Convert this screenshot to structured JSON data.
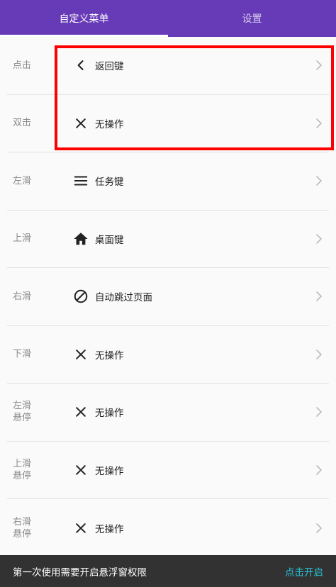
{
  "tabs": [
    {
      "label": "自定义菜单",
      "active": true
    },
    {
      "label": "设置",
      "active": false
    }
  ],
  "rows": [
    {
      "gesture": "点击",
      "action": "返回键",
      "icon": "chevron-left-icon"
    },
    {
      "gesture": "双击",
      "action": "无操作",
      "icon": "close-icon"
    },
    {
      "gesture": "左滑",
      "action": "任务键",
      "icon": "menu-icon"
    },
    {
      "gesture": "上滑",
      "action": "桌面键",
      "icon": "home-icon"
    },
    {
      "gesture": "右滑",
      "action": "自动跳过页面",
      "icon": "block-icon"
    },
    {
      "gesture": "下滑",
      "action": "无操作",
      "icon": "close-icon"
    },
    {
      "gesture": "左滑\n悬停",
      "action": "无操作",
      "icon": "close-icon"
    },
    {
      "gesture": "上滑\n悬停",
      "action": "无操作",
      "icon": "close-icon"
    },
    {
      "gesture": "右滑\n悬停",
      "action": "无操作",
      "icon": "close-icon"
    }
  ],
  "snackbar": {
    "message": "第一次使用需要开启悬浮窗权限",
    "action": "点击开启",
    "action_color": "#26c6da"
  },
  "colors": {
    "app_bar": "#673ab7",
    "highlight": "#ff0000"
  }
}
